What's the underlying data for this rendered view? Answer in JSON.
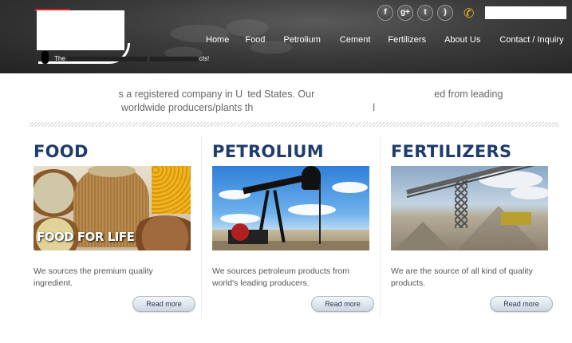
{
  "header": {
    "tagline_start": "The",
    "tagline_end": "cts!",
    "social": [
      {
        "icon": "facebook-icon",
        "glyph": "f"
      },
      {
        "icon": "google-plus-icon",
        "glyph": "g+"
      },
      {
        "icon": "twitter-icon",
        "glyph": "t"
      },
      {
        "icon": "rss-icon",
        "glyph": ")"
      }
    ],
    "phone_icon": "phone-icon",
    "nav": [
      "Home",
      "Food",
      "Petrolium",
      "Cement",
      "Fertilizers",
      "About Us",
      "Contact / Inquiry"
    ]
  },
  "intro": {
    "line1_a": "s a registered company in U",
    "line1_b": "ted States. Our",
    "line1_c": "ed from leading",
    "line2_a": "worldwide producers/plants th",
    "line2_b": "l"
  },
  "columns": [
    {
      "title": "FOOD",
      "image_label": "FOOD FOR LIFE",
      "text": "We sources the premium quality ingredient.",
      "button": "Read more"
    },
    {
      "title": "PETROLIUM",
      "text": "We sources petroleum products from world's leading producers.",
      "button": "Read more"
    },
    {
      "title": "FERTILIZERS",
      "text": "We are the source of all kind of quality products.",
      "button": "Read more"
    }
  ],
  "colors": {
    "heading": "#1f3c6e",
    "header_bg": "#3b3b3b",
    "phone_accent": "#f0b020"
  }
}
